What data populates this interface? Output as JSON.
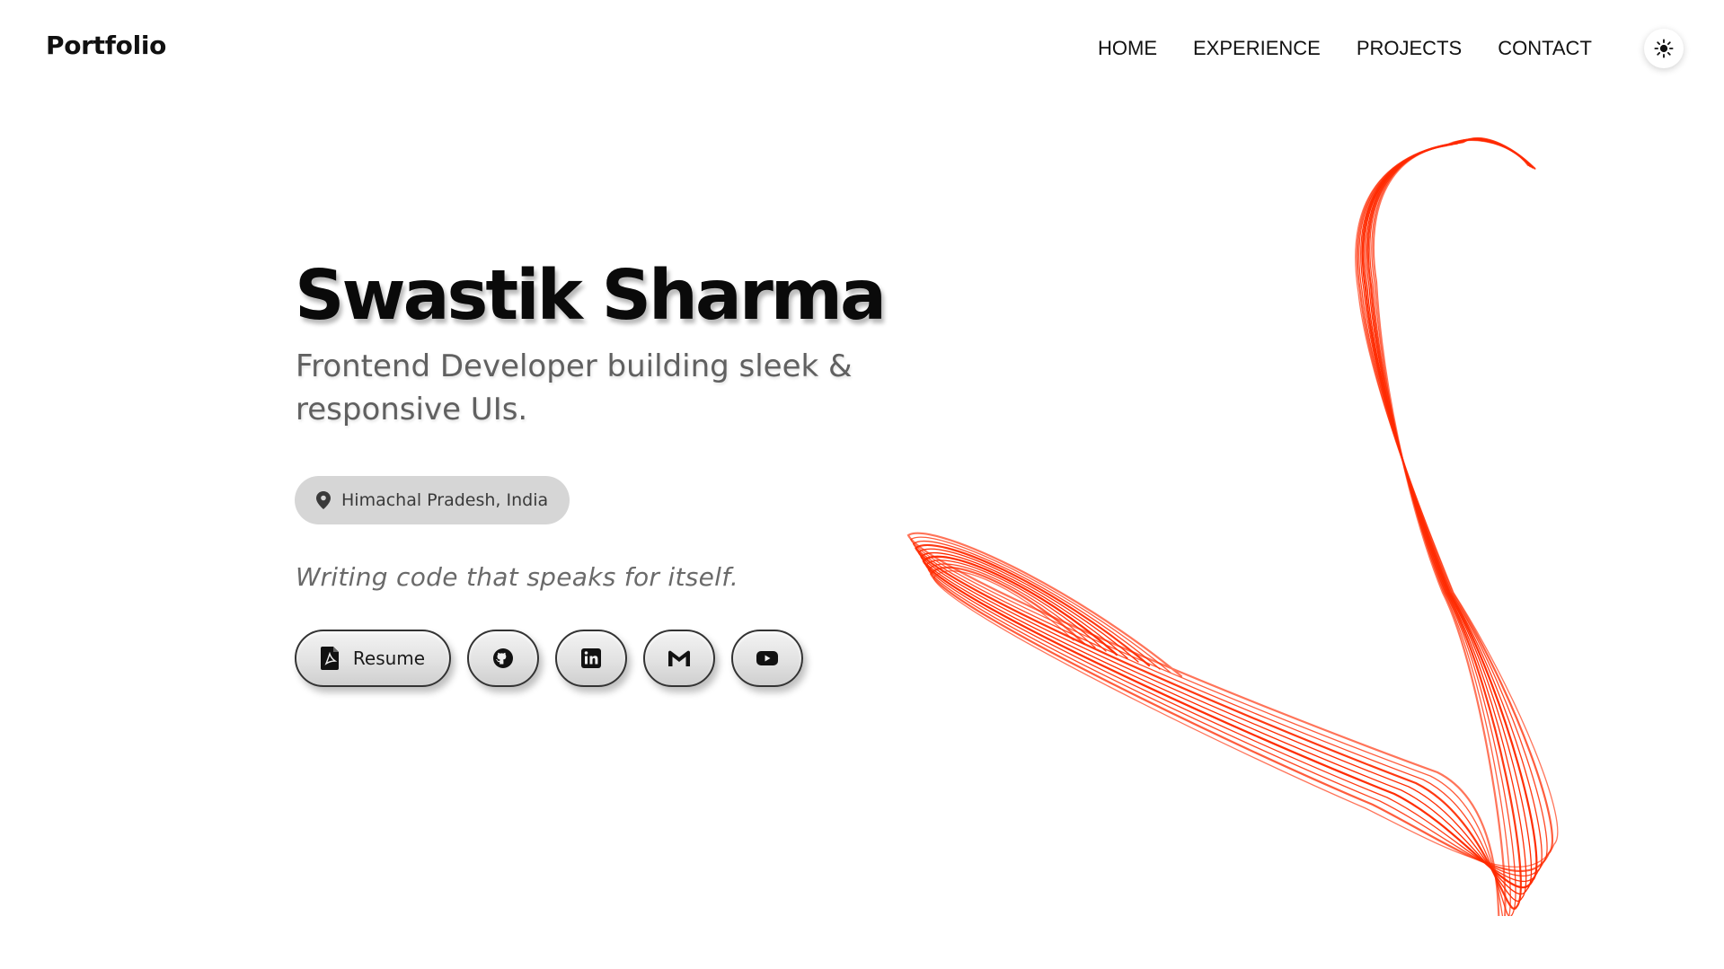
{
  "header": {
    "brand": "Portfolio",
    "nav": [
      {
        "label": "HOME"
      },
      {
        "label": "EXPERIENCE"
      },
      {
        "label": "PROJECTS"
      },
      {
        "label": "CONTACT"
      }
    ],
    "theme_toggle_icon": "sun-icon"
  },
  "hero": {
    "name": "Swastik Sharma",
    "subtitle": "Frontend Developer building sleek & responsive UIs.",
    "location": "Himachal Pradesh, India",
    "location_icon": "map-pin-icon",
    "tagline": "Writing code that speaks for itself."
  },
  "actions": {
    "resume_label": "Resume",
    "resume_icon": "pdf-file-icon",
    "links": [
      {
        "icon": "github-icon"
      },
      {
        "icon": "linkedin-icon"
      },
      {
        "icon": "gmail-icon"
      },
      {
        "icon": "youtube-icon"
      }
    ]
  },
  "colors": {
    "accent": "#ff2a00",
    "text": "#0a0a0a",
    "muted": "#606060",
    "chip": "#d6d6d6"
  }
}
